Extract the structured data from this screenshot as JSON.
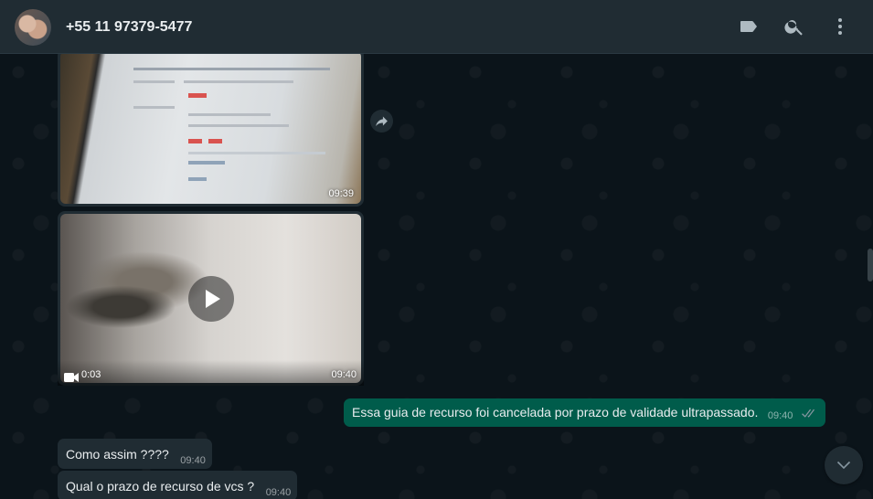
{
  "header": {
    "contact_name": "+55 11 97379-5477",
    "icons": [
      "label-icon",
      "search-icon",
      "menu-icon"
    ]
  },
  "messages": {
    "image_message": {
      "time": "09:39"
    },
    "video_message": {
      "duration": "0:03",
      "time": "09:40"
    },
    "outgoing": {
      "text": "Essa guia de recurso foi cancelada por prazo de validade ultrapassado.",
      "time": "09:40",
      "status": "read"
    },
    "incoming_1": {
      "text": "Como assim ????",
      "time": "09:40"
    },
    "incoming_2": {
      "text": "Qual o prazo de recurso de vcs ?",
      "time": "09:40"
    }
  },
  "colors": {
    "background": "#0b141a",
    "header": "#202c33",
    "outgoing_bubble": "#005c4b",
    "incoming_bubble": "#202c33",
    "text": "#e9edef"
  }
}
